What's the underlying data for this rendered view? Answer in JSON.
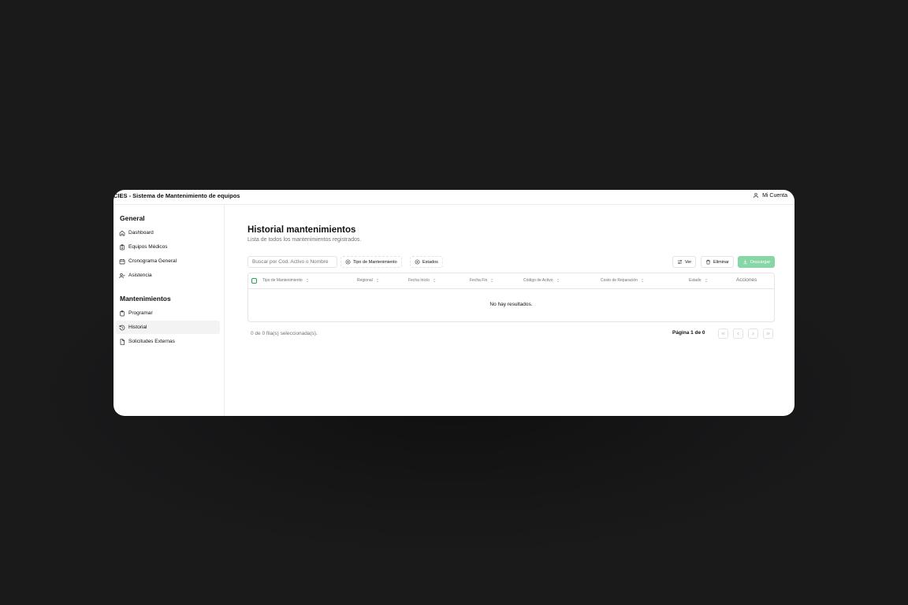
{
  "window": {
    "app_title": "CIES - Sistema de Mantenimiento de equipos",
    "account_label": "Mi Cuenta"
  },
  "sidebar": {
    "groups": [
      {
        "title": "General",
        "items": [
          {
            "label": "Dashboard",
            "icon": "home-icon"
          },
          {
            "label": "Equipos Médicos",
            "icon": "clipboard-icon"
          },
          {
            "label": "Cronograma General",
            "icon": "calendar-icon"
          },
          {
            "label": "Asistencia",
            "icon": "user-check-icon"
          }
        ]
      },
      {
        "title": "Mantenimientos",
        "items": [
          {
            "label": "Programar",
            "icon": "clipboard-icon"
          },
          {
            "label": "Historial",
            "icon": "history-icon",
            "active": true
          },
          {
            "label": "Solicitudes Externas",
            "icon": "file-icon"
          }
        ]
      }
    ]
  },
  "main": {
    "title": "Historial mantenimientos",
    "subtitle": "Lista de todos los mantenimientos registrados.",
    "search_placeholder": "Buscar por Cod. Activo o Nombre",
    "filters": {
      "tipo": "Tipo de Mantenimiento",
      "estados": "Estados"
    },
    "actions": {
      "ver": "Ver",
      "eliminar": "Eliminar",
      "descargar": "Descargar"
    },
    "table": {
      "columns": [
        "Tipo de Mantenimiento",
        "Regional",
        "Fecha Inicio",
        "Fecha Fin",
        "Código de Activo",
        "Costo de Reparación",
        "Estado"
      ],
      "actions_column": "Acciones",
      "empty_message": "No hay resultados."
    },
    "footer": {
      "selected": "0 de 0 fila(s) seleccionada(s).",
      "page": "Página 1 de 0"
    }
  },
  "colors": {
    "accent_green": "#86d6a6",
    "background": "#1a1a1b"
  }
}
